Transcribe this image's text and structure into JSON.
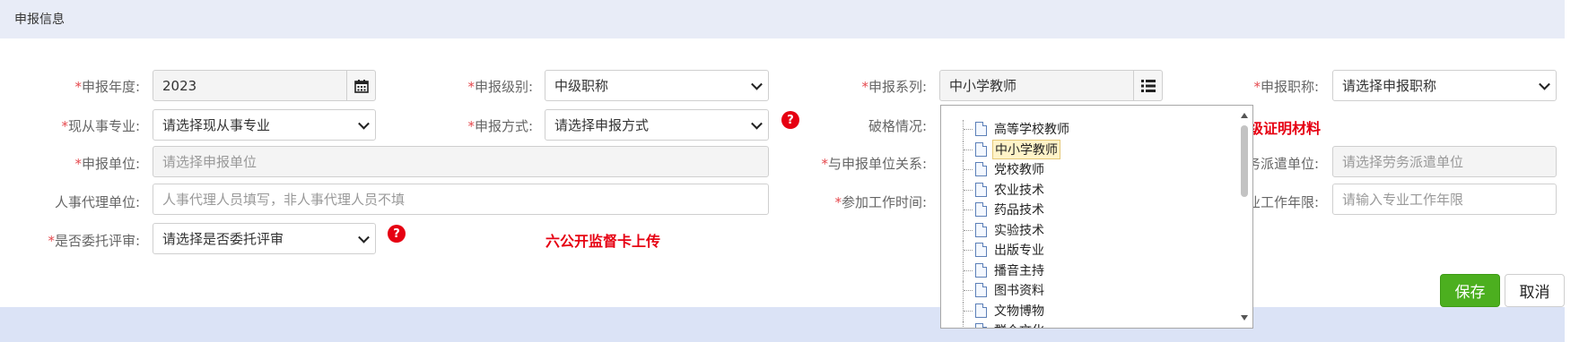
{
  "section": {
    "title": "申报信息"
  },
  "required_mark": "*",
  "form": {
    "year": {
      "label": "申报年度:",
      "value": "2023",
      "required": true
    },
    "level": {
      "label": "申报级别:",
      "value": "中级职称",
      "required": true
    },
    "series": {
      "label": "申报系列:",
      "value": "中小学教师",
      "required": true
    },
    "title_field": {
      "label": "申报职称:",
      "value": "请选择申报职称",
      "required": true
    },
    "major": {
      "label": "现从事专业:",
      "value": "请选择现从事专业",
      "required": true
    },
    "method": {
      "label": "申报方式:",
      "value": "请选择申报方式",
      "required": true
    },
    "exception": {
      "label": "破格情况:",
      "required": false
    },
    "exception_note": "级证明材料",
    "unit": {
      "label": "申报单位:",
      "placeholder": "请选择申报单位",
      "required": true
    },
    "relation": {
      "label": "与申报单位关系:",
      "required": true
    },
    "dispatch_unit": {
      "label": "务派遣单位:",
      "placeholder": "请选择劳务派遣单位",
      "required": false
    },
    "hr_agency": {
      "label": "人事代理单位:",
      "placeholder": "人事代理人员填写，非人事代理人员不填",
      "required": false
    },
    "work_time": {
      "label": "参加工作时间:",
      "required": true
    },
    "work_years": {
      "label": "业工作年限:",
      "placeholder": "请输入专业工作年限",
      "required": false
    },
    "entrust": {
      "label": "是否委托评审:",
      "value": "请选择是否委托评审",
      "required": true
    }
  },
  "notes": {
    "supervision": "六公开监督卡上传",
    "help_mark": "?"
  },
  "series_tree": {
    "items": [
      {
        "label": "高等学校教师",
        "selected": false
      },
      {
        "label": "中小学教师",
        "selected": true
      },
      {
        "label": "党校教师",
        "selected": false
      },
      {
        "label": "农业技术",
        "selected": false
      },
      {
        "label": "药品技术",
        "selected": false
      },
      {
        "label": "实验技术",
        "selected": false
      },
      {
        "label": "出版专业",
        "selected": false
      },
      {
        "label": "播音主持",
        "selected": false
      },
      {
        "label": "图书资料",
        "selected": false
      },
      {
        "label": "文物博物",
        "selected": false
      },
      {
        "label": "群众文化",
        "selected": false
      }
    ]
  },
  "buttons": {
    "save": "保存",
    "cancel": "取消"
  },
  "colors": {
    "save": "#4caf1f",
    "required": "#e5484d",
    "note_red": "#e60012",
    "header_bg": "#e8ecf7"
  }
}
